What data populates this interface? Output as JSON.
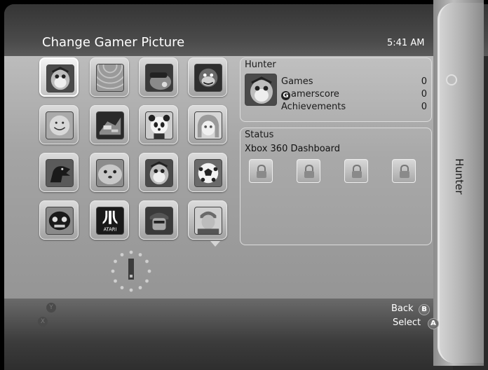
{
  "header": {
    "title": "Change Gamer Picture",
    "clock": "5:41 AM"
  },
  "blade": {
    "label": "Hunter"
  },
  "picture_grid": {
    "rows": [
      [
        "owl-mascot",
        "rings",
        "goggles-creature",
        "monkey"
      ],
      [
        "smiley",
        "robot-dragon",
        "panda",
        "anime-girl"
      ],
      [
        "dinosaur",
        "seal-pup",
        "owl-mascot",
        "soccer-ball"
      ],
      [
        "mask-creature",
        "atari-logo",
        "soldier",
        "pilot"
      ]
    ],
    "atari_text": "ATARI"
  },
  "profile": {
    "gamertag": "Hunter",
    "stats": [
      {
        "label": "Games",
        "value": "0"
      },
      {
        "label": "amerscore",
        "badge": "G",
        "value": "0"
      },
      {
        "label": "Achievements",
        "value": "0"
      }
    ]
  },
  "status": {
    "title": "Status",
    "text": "Xbox 360 Dashboard",
    "slots": [
      "locked",
      "locked",
      "locked",
      "locked"
    ]
  },
  "buttons": {
    "back": {
      "label": "Back",
      "glyph": "B"
    },
    "select": {
      "label": "Select",
      "glyph": "A"
    },
    "y_glyph": "Y",
    "x_glyph": "X"
  }
}
